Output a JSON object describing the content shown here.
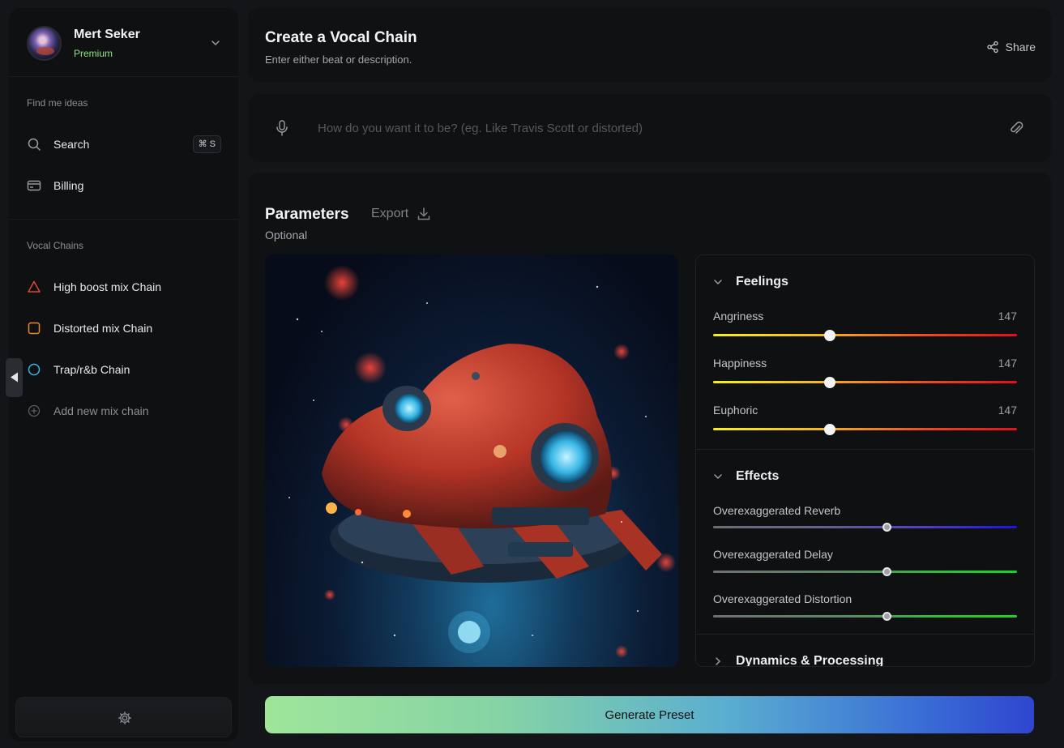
{
  "user": {
    "name": "Mert Seker",
    "plan": "Premium"
  },
  "sidebar": {
    "ideas_label": "Find me ideas",
    "search": {
      "label": "Search",
      "shortcut": "⌘ S"
    },
    "billing": {
      "label": "Billing"
    },
    "chains_label": "Vocal Chains",
    "chains": [
      {
        "label": "High boost mix Chain",
        "icon": "triangle-icon",
        "color": "#e0463d"
      },
      {
        "label": "Distorted mix Chain",
        "icon": "square-icon",
        "color": "#e8882f"
      },
      {
        "label": "Trap/r&b Chain",
        "icon": "circle-icon",
        "color": "#35b5e8"
      }
    ],
    "add_chain": "Add new mix chain"
  },
  "header": {
    "title": "Create a Vocal Chain",
    "subtitle": "Enter either beat or description.",
    "share_label": "Share"
  },
  "prompt": {
    "placeholder": "How do you want it to be? (eg. Like Travis Scott or distorted)"
  },
  "parameters": {
    "title": "Parameters",
    "export_label": "Export",
    "optional_label": "Optional"
  },
  "feelings": {
    "title": "Feelings",
    "sliders": [
      {
        "label": "Angriness",
        "value": "147",
        "level": 0.385
      },
      {
        "label": "Happiness",
        "value": "147",
        "level": 0.385
      },
      {
        "label": "Euphoric",
        "value": "147",
        "level": 0.385
      }
    ]
  },
  "effects": {
    "title": "Effects",
    "sliders": [
      {
        "label": "Overexaggerated Reverb",
        "level": 0.57,
        "color": "blue"
      },
      {
        "label": "Overexaggerated Delay",
        "level": 0.57,
        "color": "green"
      },
      {
        "label": "Overexaggerated Distortion",
        "level": 0.57,
        "color": "green"
      }
    ]
  },
  "dynamics": {
    "title": "Dynamics & Processing"
  },
  "generate_label": "Generate Preset",
  "colors": {
    "accent_green": "#8fe38a",
    "panel_bg": "#101113"
  }
}
